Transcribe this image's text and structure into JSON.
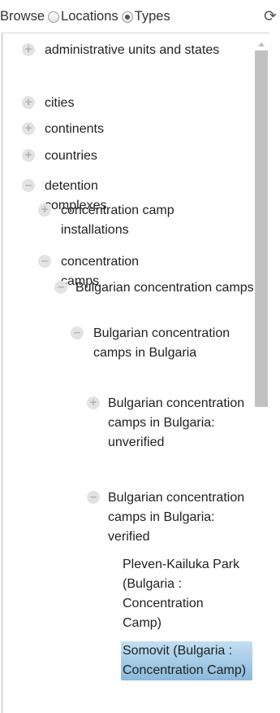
{
  "header": {
    "browse_label": "Browse",
    "locations_label": "Locations",
    "types_label": "Types",
    "selected_mode": "Types",
    "refresh_icon": "refresh-icon"
  },
  "tree": {
    "items": [
      {
        "label": "administrative units and states",
        "state": "collapsed"
      },
      {
        "label": "cities",
        "state": "collapsed"
      },
      {
        "label": "continents",
        "state": "collapsed"
      },
      {
        "label": "countries",
        "state": "collapsed"
      },
      {
        "label": "detention complexes",
        "state": "expanded"
      },
      {
        "label": "concentration camp installations",
        "state": "collapsed"
      },
      {
        "label": "concentration camps",
        "state": "expanded"
      },
      {
        "label": "Bulgarian concentration camps",
        "state": "expanded"
      },
      {
        "label": "Bulgarian concentration camps in Bulgaria",
        "state": "expanded"
      },
      {
        "label": "Bulgarian concentration camps in Bulgaria: unverified",
        "state": "collapsed"
      },
      {
        "label": "Bulgarian concentration camps in Bulgaria: verified",
        "state": "expanded"
      },
      {
        "label": "Pleven-Kailuka Park (Bulgaria : Concentration Camp)",
        "state": "leaf"
      },
      {
        "label": "Somovit (Bulgaria : Concentration Camp)",
        "state": "leaf-selected"
      }
    ]
  },
  "colors": {
    "selected_bg": "#9cc6e4",
    "toggle_bg": "#e3e3e3",
    "scrollbar_thumb": "#c1c1c1"
  }
}
